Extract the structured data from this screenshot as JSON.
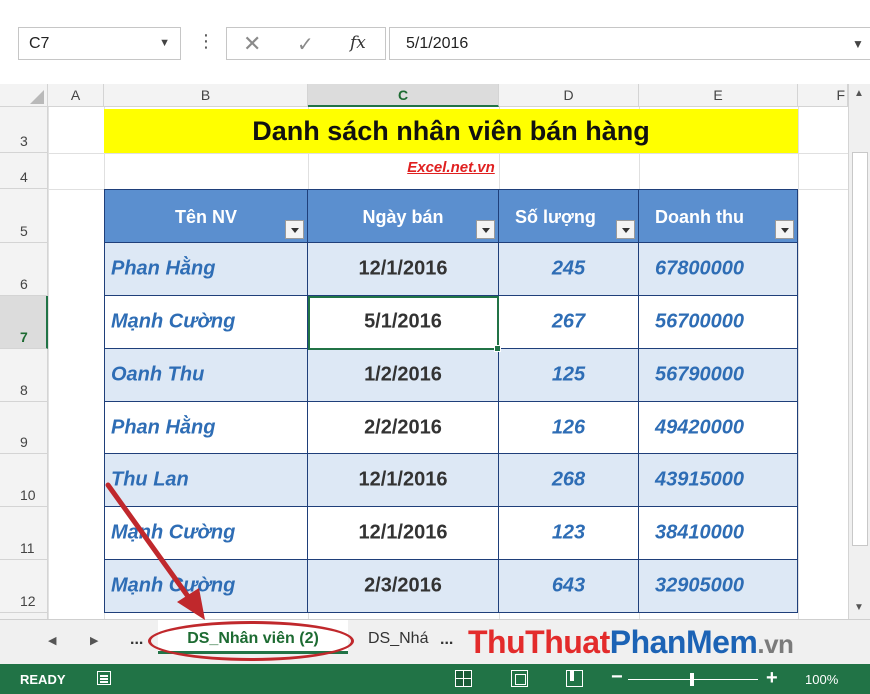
{
  "formula_bar": {
    "name_box": "C7",
    "dots": "⋮",
    "cancel_glyph": "✕",
    "enter_glyph": "✓",
    "fx_label": "fx",
    "formula": "5/1/2016"
  },
  "columns": [
    "A",
    "B",
    "C",
    "D",
    "E",
    "F"
  ],
  "active_column": "C",
  "rows": [
    "3",
    "4",
    "5",
    "6",
    "7",
    "8",
    "9",
    "10",
    "11",
    "12"
  ],
  "active_row": "7",
  "sheet": {
    "title": "Danh sách nhân viên bán hàng",
    "subtitle": "Excel.net.vn",
    "headers": [
      "Tên NV",
      "Ngày bán",
      "Số lượng",
      "Doanh thu"
    ],
    "records": [
      {
        "name": "Phan Hằng",
        "date": "12/1/2016",
        "qty": "245",
        "revenue": "67800000"
      },
      {
        "name": "Mạnh Cường",
        "date": "5/1/2016",
        "qty": "267",
        "revenue": "56700000"
      },
      {
        "name": "Oanh Thu",
        "date": "1/2/2016",
        "qty": "125",
        "revenue": "56790000"
      },
      {
        "name": "Phan Hằng",
        "date": "2/2/2016",
        "qty": "126",
        "revenue": "49420000"
      },
      {
        "name": "Thu Lan",
        "date": "12/1/2016",
        "qty": "268",
        "revenue": "43915000"
      },
      {
        "name": "Mạnh Cường",
        "date": "12/1/2016",
        "qty": "123",
        "revenue": "38410000"
      },
      {
        "name": "Mạnh Cường",
        "date": "2/3/2016",
        "qty": "643",
        "revenue": "32905000"
      }
    ]
  },
  "tabs": {
    "more_left": "...",
    "active": "DS_Nhân viên (2)",
    "second": "DS_Nhá",
    "more_right": "..."
  },
  "watermark": {
    "part1": "Thu",
    "part2": "Thuat",
    "part3": "PhanMem",
    "part4": ".vn"
  },
  "status": {
    "ready": "READY",
    "zoom": "100%"
  },
  "colors": {
    "accent": "#217346",
    "title_band": "#ffff00",
    "table_header": "#5b8fcf",
    "band_light": "#dde8f5",
    "text_blue": "#2e6db5",
    "subtitle_red": "#e02020",
    "annotation": "#c0282c"
  },
  "icons": {
    "name_box_dropdown": "chevron-down-icon",
    "cancel": "close-icon",
    "enter": "check-icon",
    "fx": "function-icon",
    "filter": "filter-dropdown-icon",
    "macro": "macro-record-icon"
  }
}
